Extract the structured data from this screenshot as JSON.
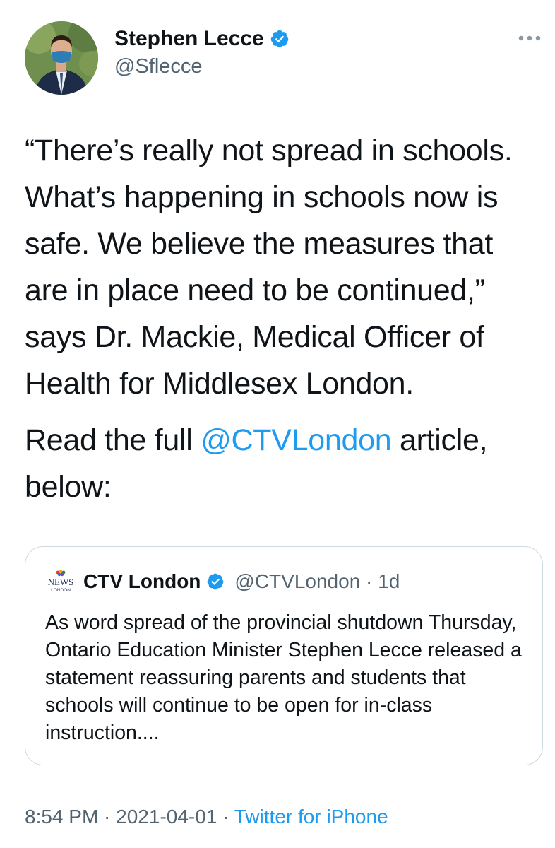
{
  "author": {
    "name": "Stephen Lecce",
    "handle": "@Sflecce",
    "verified": true,
    "avatar": "profile-photo"
  },
  "more_icon": "ellipsis-icon",
  "tweet": {
    "text_part1": "“There’s really not spread in schools. What’s happening in schools now is safe. We believe the measures that are in place need to be continued,” says Dr. Mackie, Medical Officer of Health for Middlesex London.",
    "text_part2_before": "Read the full ",
    "mention": "@CTVLondon",
    "text_part2_after": " article, below:"
  },
  "quoted_tweet": {
    "logo_text": "NEWS",
    "logo_subtext": "LONDON",
    "name": "CTV London",
    "verified": true,
    "handle_time": "@CTVLondon · 1d",
    "text": "As word spread of the provincial shutdown Thursday, Ontario Education Minister Stephen Lecce released a statement reassuring parents and students that schools will continue to be open for in-class instruction...."
  },
  "footer": {
    "time_date": "8:54 PM · 2021-04-01 · ",
    "source": "Twitter for iPhone"
  },
  "colors": {
    "link": "#1d9bf0",
    "secondary_text": "#536471",
    "border": "#cfd9de"
  }
}
